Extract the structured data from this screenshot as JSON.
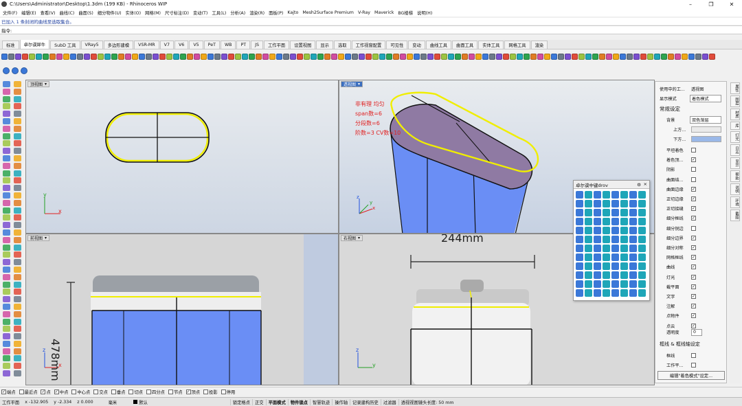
{
  "window": {
    "title": "C:\\Users\\Administrator\\Desktop\\1.3dm (199 KB) - Rhinoceros WIP",
    "minimize": "–",
    "maximize": "❐",
    "close": "✕"
  },
  "menu": [
    "文件(F)",
    "编辑(E)",
    "查看(V)",
    "曲线(C)",
    "曲面(S)",
    "细分物件(U)",
    "实体(O)",
    "网格(M)",
    "尺寸标注(D)",
    "变动(T)",
    "工具(L)",
    "分析(A)",
    "渲染(R)",
    "面板(P)",
    "Kajto",
    "Mesh2Surface Premium",
    "V-Ray",
    "Maverick",
    "BG楼梯",
    "说明(H)"
  ],
  "command": {
    "history": "已加入 1 条封闭的曲线至选取集合。",
    "prompt": "指令:"
  },
  "tabs": [
    "标准",
    "卓尔谟犀牛",
    "SubD 工具",
    "VRay5",
    "多边形建模",
    "VSR-MR",
    "V7",
    "V6",
    "V5",
    "PeT",
    "WB",
    "PT",
    "JS",
    "工作平面",
    "设置视图",
    "显示",
    "选取",
    "工作视窗配置",
    "可见性",
    "变动",
    "曲线工具",
    "曲面工具",
    "实体工具",
    "网格工具",
    "渲染"
  ],
  "active_tab": "卓尔谟犀牛",
  "viewports": {
    "top": {
      "label": "顶视图"
    },
    "perspective": {
      "label": "透视图",
      "annotations": [
        "非有理  均匀",
        "span数=6",
        "分段数=6",
        "阶数=3   CV数=10"
      ]
    },
    "front": {
      "label": "前视图",
      "dimension": "478mm"
    },
    "right": {
      "label": "右视图",
      "dimension": "244mm"
    },
    "arrow": "▾",
    "axes": {
      "x": "x",
      "y": "y",
      "z": "z"
    }
  },
  "float_toolbar": {
    "title": "卓尔谟中键drov",
    "gear": "⚙",
    "close": "×"
  },
  "properties": {
    "rows": [
      {
        "label": "使用中的工...",
        "value": "透视图"
      },
      {
        "label": "显示模式",
        "value": "着色模式"
      },
      {
        "label": "常规设定",
        "value": ""
      },
      {
        "label": "背景",
        "value": "双色渐层"
      },
      {
        "label": "上方...",
        "value": ""
      },
      {
        "label": "下方...",
        "value": ""
      }
    ],
    "checks": [
      {
        "label": "平坦着色",
        "checked": false
      },
      {
        "label": "着色顶...",
        "checked": true
      },
      {
        "label": "阴影",
        "checked": false
      },
      {
        "label": "曲面结...",
        "checked": false
      },
      {
        "label": "曲面边缘",
        "checked": true
      },
      {
        "label": "正切边缘",
        "checked": true
      },
      {
        "label": "正切接缝",
        "checked": true
      },
      {
        "label": "细分框线",
        "checked": true
      },
      {
        "label": "细分锐边",
        "checked": false
      },
      {
        "label": "细分边界",
        "checked": true
      },
      {
        "label": "细分对称",
        "checked": true
      },
      {
        "label": "网格框线",
        "checked": true
      },
      {
        "label": "曲线",
        "checked": true
      },
      {
        "label": "灯光",
        "checked": true
      },
      {
        "label": "截平面",
        "checked": true
      },
      {
        "label": "文字",
        "checked": true
      },
      {
        "label": "注解",
        "checked": true
      },
      {
        "label": "点物件",
        "checked": true
      },
      {
        "label": "点云",
        "checked": true
      }
    ],
    "transparency_label": "透明度",
    "transparency_value": "0",
    "section2": "框线 & 框线轴设定",
    "checks2": [
      {
        "label": "框线",
        "checked": false
      },
      {
        "label": "工作平...",
        "checked": false
      }
    ],
    "edit_button": "编辑\"着色模式\"设定..."
  },
  "panel_tabs": [
    "属性",
    "图层",
    "材质",
    "库",
    "灯光",
    "日志",
    "显示",
    "帮助",
    "说明",
    "环境",
    "截图"
  ],
  "snap": [
    {
      "label": "端点",
      "checked": true
    },
    {
      "label": "最近点",
      "checked": false
    },
    {
      "label": "点",
      "checked": true
    },
    {
      "label": "中点",
      "checked": true
    },
    {
      "label": "中心点",
      "checked": false
    },
    {
      "label": "交点",
      "checked": false
    },
    {
      "label": "垂点",
      "checked": false
    },
    {
      "label": "切点",
      "checked": false
    },
    {
      "label": "四分点",
      "checked": false
    },
    {
      "label": "节点",
      "checked": false
    },
    {
      "label": "顶点",
      "checked": true
    },
    {
      "label": "投影",
      "checked": false
    },
    {
      "label": "停用",
      "checked": false
    }
  ],
  "status": {
    "plane": "工作平面",
    "x": "x -132.905",
    "y": "y -2.334",
    "z": "z 0.000",
    "unit": "毫米",
    "layer": "默认",
    "panes": [
      "锁定格点",
      "正交",
      "平面模式",
      "物件锁点",
      "智慧轨迹",
      "操作轴",
      "记录建构历史",
      "过滤器",
      "透视视图镜头长度: 50 mm"
    ]
  },
  "colors": {
    "viewport_bg_top": "#e4e8ec",
    "viewport_bg_bottom": "#93acd8",
    "curve": "#f0ee00",
    "active_view": "#3c6fbf",
    "annotation": "#e02020",
    "surface": "#6a8ef5"
  }
}
